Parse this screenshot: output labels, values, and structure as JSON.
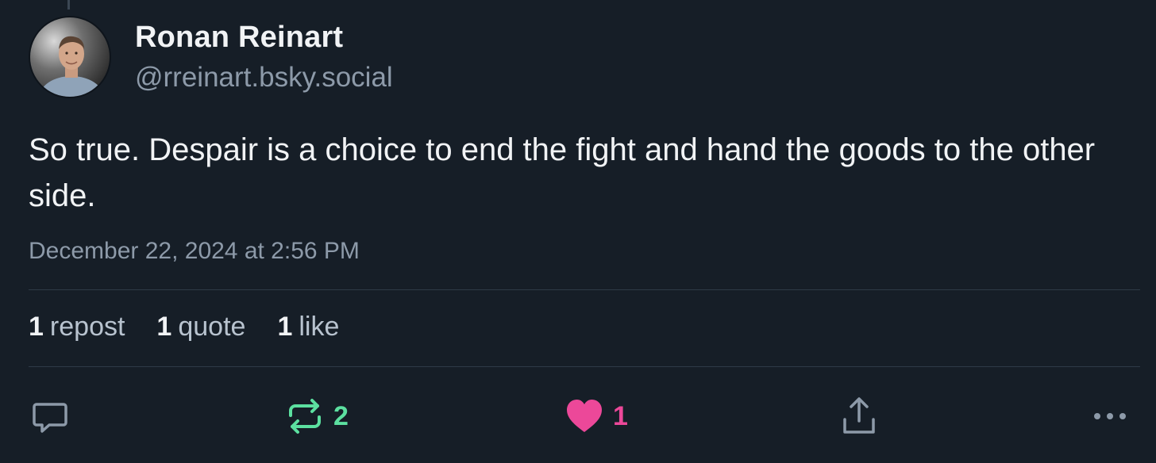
{
  "author": {
    "name": "Ronan Reinart",
    "handle": "@rreinart.bsky.social"
  },
  "post": {
    "text": "So true. Despair is a choice to end the fight and hand the goods to the other side.",
    "timestamp": "December 22, 2024 at 2:56 PM"
  },
  "stats": [
    {
      "count": "1",
      "label": "repost"
    },
    {
      "count": "1",
      "label": "quote"
    },
    {
      "count": "1",
      "label": "like"
    }
  ],
  "actions": {
    "reply": {
      "icon": "reply-icon"
    },
    "repost": {
      "icon": "repost-icon",
      "count": "2",
      "color": "#5ce0a0"
    },
    "like": {
      "icon": "heart-icon",
      "count": "1",
      "color": "#ec4899"
    },
    "share": {
      "icon": "share-icon"
    },
    "more": {
      "icon": "more-icon"
    }
  },
  "colors": {
    "background": "#161e27",
    "text": "#f1f3f5",
    "muted": "#8d9aa9",
    "divider": "#2e3a47"
  }
}
